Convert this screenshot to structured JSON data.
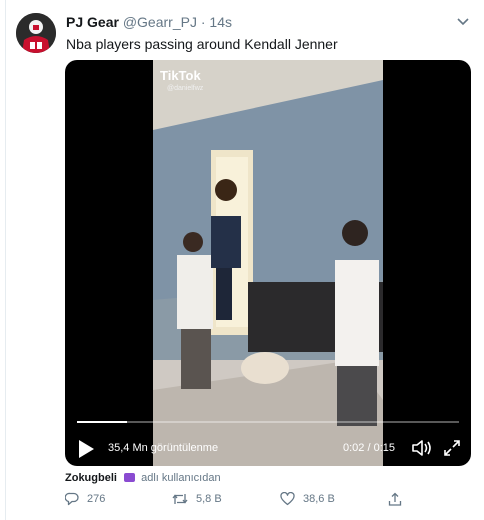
{
  "tweet": {
    "display_name": "PJ Gear",
    "handle": "@Gearr_PJ",
    "separator": "·",
    "time": "14s",
    "text": "Nba players passing around Kendall Jenner"
  },
  "video": {
    "watermark": "TikTok",
    "watermark_user": "@danielfwz",
    "views": "35,4 Mn görüntülenme",
    "elapsed": "0:02",
    "duration": "0:15",
    "timer": "0:02 / 0:15",
    "progress_fraction": 0.13
  },
  "attribution": {
    "user": "Zokugbeli",
    "note": "adlı kullanıcıdan"
  },
  "actions": {
    "replies": "276",
    "retweets": "5,8 B",
    "likes": "38,6 B"
  },
  "icons": {
    "caret": "chevron-down-icon",
    "play": "play-icon",
    "volume": "volume-icon",
    "fullscreen": "fullscreen-icon",
    "reply": "reply-icon",
    "retweet": "retweet-icon",
    "like": "heart-icon",
    "share": "share-icon",
    "badge": "purple-badge-icon"
  },
  "colors": {
    "text": "#14171a",
    "secondary": "#657786",
    "video_bg": "#000000",
    "badge": "#8a4bd1"
  }
}
